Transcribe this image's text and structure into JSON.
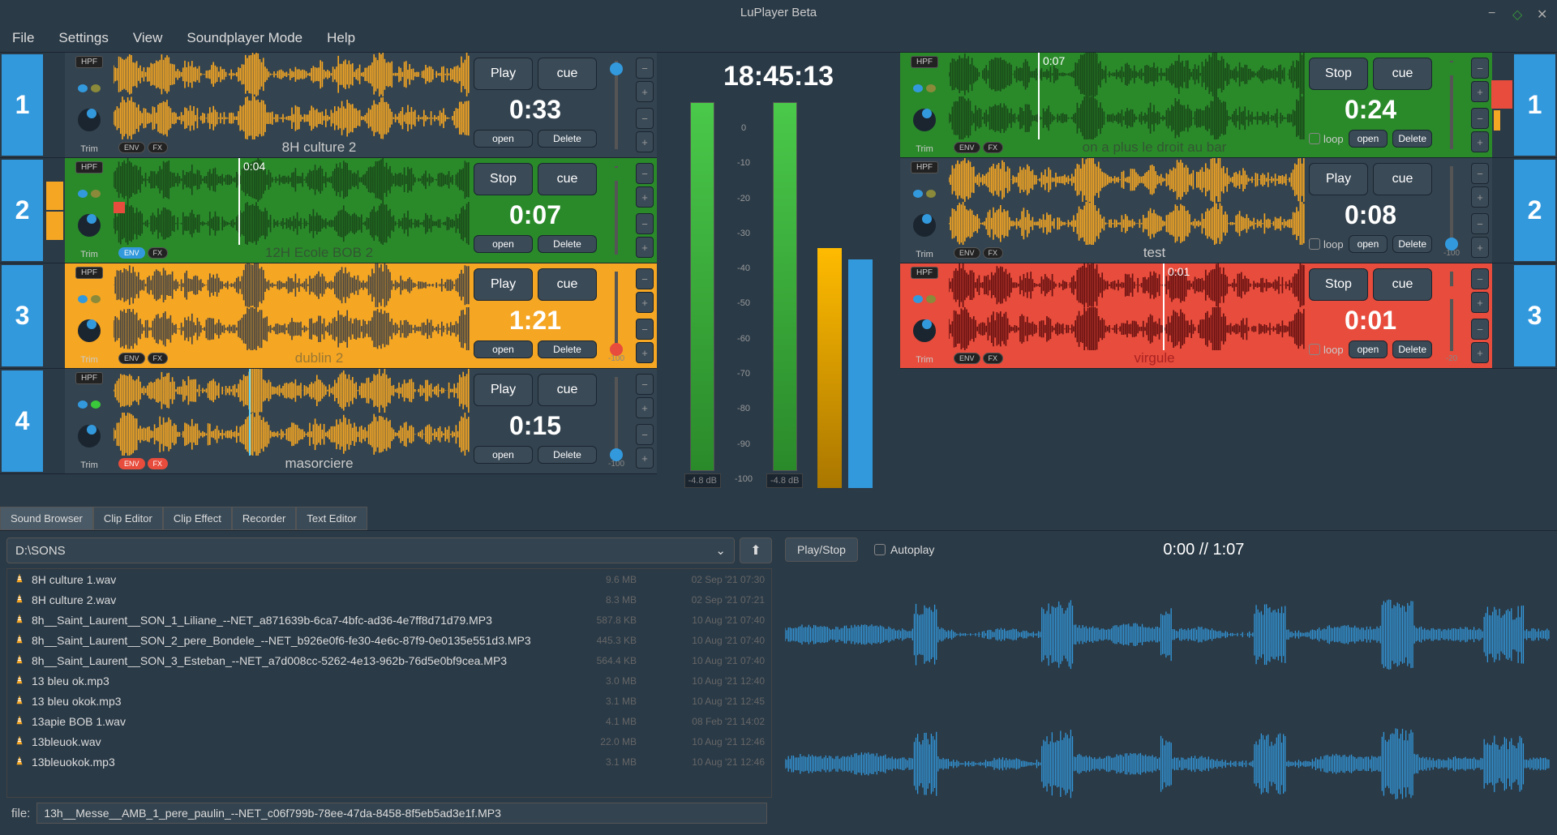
{
  "titlebar": {
    "title": "LuPlayer Beta"
  },
  "menu": [
    "File",
    "Settings",
    "View",
    "Soundplayer Mode",
    "Help"
  ],
  "clock": "18:45:13",
  "meter_labels": {
    "left": "-4.8 dB",
    "right": "-4.8 dB"
  },
  "scale": [
    "0",
    "-10",
    "-20",
    "-30",
    "-40",
    "-50",
    "-60",
    "-70",
    "-80",
    "-90",
    "-100"
  ],
  "left_players": [
    {
      "num": "1",
      "bg": "darkpanel",
      "hpf": "HPF",
      "trim": "Trim",
      "env": "ENV",
      "fx": "FX",
      "name": "8H culture 2",
      "play": "Play",
      "cue": "cue",
      "open": "open",
      "delete": "Delete",
      "time": "0:33",
      "playhead": null,
      "slider_val": "",
      "env_on": false,
      "fx_on": false,
      "indicator": ""
    },
    {
      "num": "2",
      "bg": "green",
      "hpf": "HPF",
      "trim": "Trim",
      "env": "ENV",
      "fx": "FX",
      "name": "12H Ecole BOB 2",
      "play": "Stop",
      "cue": "cue",
      "open": "open",
      "delete": "Delete",
      "time": "0:07",
      "playhead": "0:04",
      "slider_val": "",
      "env_on": true,
      "fx_on": false,
      "indicator": "orange"
    },
    {
      "num": "3",
      "bg": "orange",
      "hpf": "HPF",
      "trim": "Trim",
      "env": "ENV",
      "fx": "FX",
      "name": "dublin 2",
      "play": "Play",
      "cue": "cue",
      "open": "open",
      "delete": "Delete",
      "time": "1:21",
      "playhead": null,
      "slider_val": "-100",
      "env_on": false,
      "fx_on": false,
      "indicator": ""
    },
    {
      "num": "4",
      "bg": "darkpanel",
      "hpf": "HPF",
      "trim": "Trim",
      "env": "ENV",
      "fx": "FX",
      "name": "masorciere",
      "play": "Play",
      "cue": "cue",
      "open": "open",
      "delete": "Delete",
      "time": "0:15",
      "playhead": null,
      "slider_val": "-100",
      "env_on": false,
      "fx_on": false,
      "env_red": true,
      "indicator": ""
    }
  ],
  "right_players": [
    {
      "num": "1",
      "bg": "green",
      "hpf": "HPF",
      "trim": "Trim",
      "env": "ENV",
      "fx": "FX",
      "name": "on a plus le droit au bar",
      "play": "Stop",
      "cue": "cue",
      "open": "open",
      "delete": "Delete",
      "time": "0:24",
      "playhead": "0:07",
      "slider_val": "",
      "loop": "loop",
      "indicator": "red-orange"
    },
    {
      "num": "2",
      "bg": "darkpanel",
      "hpf": "HPF",
      "trim": "Trim",
      "env": "ENV",
      "fx": "FX",
      "name": "test",
      "play": "Play",
      "cue": "cue",
      "open": "open",
      "delete": "Delete",
      "time": "0:08",
      "playhead": null,
      "slider_val": "-100",
      "loop": "loop",
      "indicator": ""
    },
    {
      "num": "3",
      "bg": "red",
      "hpf": "HPF",
      "trim": "Trim",
      "env": "ENV",
      "fx": "FX",
      "name": "virgule",
      "play": "Stop",
      "cue": "cue",
      "open": "open",
      "delete": "Delete",
      "time": "0:01",
      "playhead": "0:01",
      "slider_val": "-20",
      "loop": "loop",
      "indicator": ""
    }
  ],
  "tabs": [
    "Sound Browser",
    "Clip Editor",
    "Clip Effect",
    "Recorder",
    "Text Editor"
  ],
  "browser": {
    "path": "D:\\SONS",
    "files": [
      {
        "name": "8H culture 1.wav",
        "size": "9.6 MB",
        "date": "02 Sep '21 07:30"
      },
      {
        "name": "8H culture 2.wav",
        "size": "8.3 MB",
        "date": "02 Sep '21 07:21"
      },
      {
        "name": "8h__Saint_Laurent__SON_1_Liliane_--NET_a871639b-6ca7-4bfc-ad36-4e7ff8d71d79.MP3",
        "size": "587.8 KB",
        "date": "10 Aug '21 07:40"
      },
      {
        "name": "8h__Saint_Laurent__SON_2_pere_Bondele_--NET_b926e0f6-fe30-4e6c-87f9-0e0135e551d3.MP3",
        "size": "445.3 KB",
        "date": "10 Aug '21 07:40"
      },
      {
        "name": "8h__Saint_Laurent__SON_3_Esteban_--NET_a7d008cc-5262-4e13-962b-76d5e0bf9cea.MP3",
        "size": "564.4 KB",
        "date": "10 Aug '21 07:40"
      },
      {
        "name": "13 bleu ok.mp3",
        "size": "3.0 MB",
        "date": "10 Aug '21 12:40"
      },
      {
        "name": "13 bleu okok.mp3",
        "size": "3.1 MB",
        "date": "10 Aug '21 12:45"
      },
      {
        "name": "13apie BOB 1.wav",
        "size": "4.1 MB",
        "date": "08 Feb '21 14:02"
      },
      {
        "name": "13bleuok.wav",
        "size": "22.0 MB",
        "date": "10 Aug '21 12:46"
      },
      {
        "name": "13bleuokok.mp3",
        "size": "3.1 MB",
        "date": "10 Aug '21 12:46"
      }
    ],
    "current_label": "file:",
    "current": "13h__Messe__AMB_1_pere_paulin_--NET_c06f799b-78ee-47da-8458-8f5eb5ad3e1f.MP3"
  },
  "preview": {
    "playstop": "Play/Stop",
    "autoplay": "Autoplay",
    "time": "0:00 // 1:07"
  }
}
